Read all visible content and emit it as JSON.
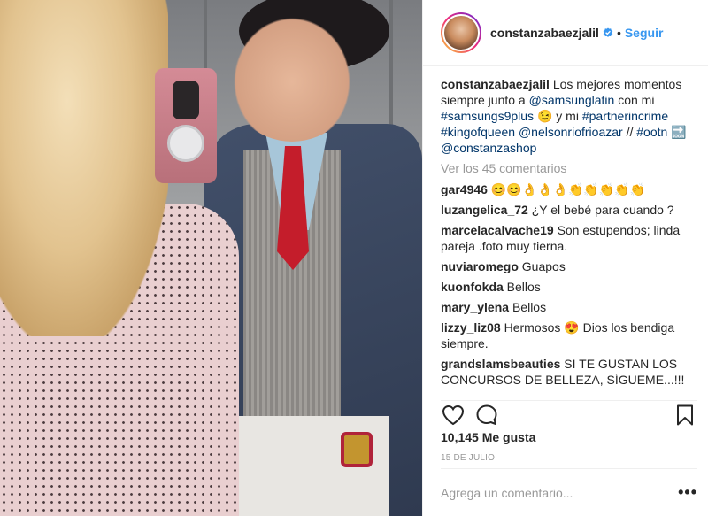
{
  "header": {
    "username": "constanzabaezjalil",
    "separator": "•",
    "follow_label": "Seguir"
  },
  "caption": {
    "username": "constanzabaezjalil",
    "text_1": "Los mejores momentos siempre junto a",
    "mention_1": "@samsunglatin",
    "text_2": "con mi",
    "hashtag_1": "#samsungs9plus",
    "emoji_1": "😉",
    "text_3": "y mi",
    "hashtag_2": "#partnerincrime",
    "hashtag_3": "#kingofqueen",
    "mention_2": "@nelsonriofrioazar",
    "text_4": "//",
    "hashtag_4": "#ootn",
    "soon_arrow": "🔜",
    "mention_3": "@constanzashop"
  },
  "view_more_label": "Ver los 45 comentarios",
  "comments": [
    {
      "user": "gar4946",
      "text": "😊😊👌👌👌👏👏👏👏👏"
    },
    {
      "user": "luzangelica_72",
      "text": "¿Y el bebé para cuando ?"
    },
    {
      "user": "marcelacalvache19",
      "text": "Son estupendos; linda pareja .foto muy tierna."
    },
    {
      "user": "nuviaromego",
      "text": "Guapos"
    },
    {
      "user": "kuonfokda",
      "text": "Bellos"
    },
    {
      "user": "mary_ylena",
      "text": "Bellos"
    },
    {
      "user": "lizzy_liz08",
      "text": "Hermosos 😍 Dios los bendiga siempre."
    },
    {
      "user": "grandslamsbeauties",
      "text": "SI TE GUSTAN LOS CONCURSOS DE BELLEZA, SÍGUEME...!!!"
    }
  ],
  "likes_label": "10,145 Me gusta",
  "date_label": "15 DE JULIO",
  "add_comment_placeholder": "Agrega un comentario...",
  "more_options": "•••",
  "icons": {
    "like": "heart-icon",
    "comment": "comment-icon",
    "save": "bookmark-icon",
    "verified": "verified-badge-icon"
  },
  "colors": {
    "link": "#003569",
    "follow": "#3897f0",
    "muted": "#999999",
    "verified": "#3897f0"
  }
}
